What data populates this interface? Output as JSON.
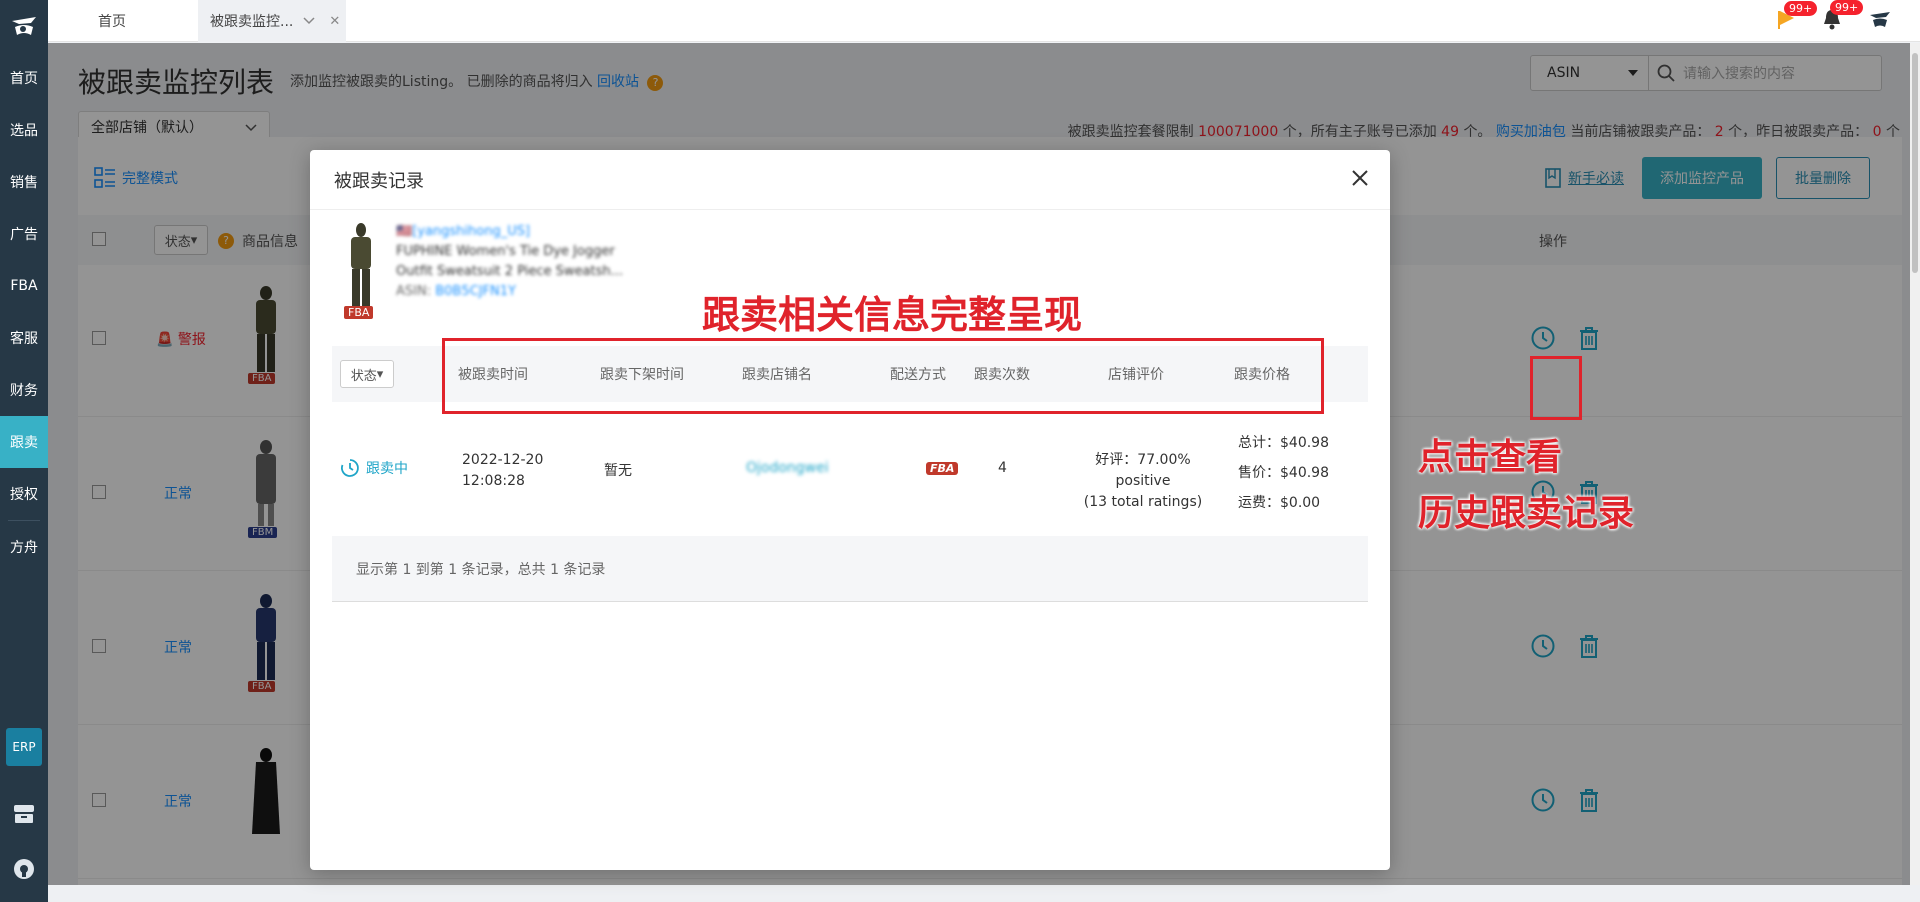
{
  "sidebar": {
    "items": [
      {
        "label": "首页"
      },
      {
        "label": "选品"
      },
      {
        "label": "销售"
      },
      {
        "label": "广告"
      },
      {
        "label": "FBA"
      },
      {
        "label": "客服"
      },
      {
        "label": "财务"
      },
      {
        "label": "跟卖"
      },
      {
        "label": "授权"
      },
      {
        "label": "方舟"
      }
    ],
    "active": "跟卖",
    "erp_label": "ERP"
  },
  "tabs": {
    "home": "首页",
    "current": "被跟卖监控..."
  },
  "notifications": {
    "flag_badge": "99+",
    "bell_badge": "99+"
  },
  "page": {
    "title": "被跟卖监控列表",
    "subtitle": "添加监控被跟卖的Listing。 已删除的商品将归入",
    "recycle_link": "回收站",
    "store_select": "全部店铺（默认）",
    "search_type": "ASIN",
    "search_placeholder": "请输入搜索的内容",
    "quota": {
      "prefix": "被跟卖监控套餐限制",
      "limit": "100071000",
      "mid1": "个，所有主子账号已添加",
      "added": "49",
      "mid2": "个。",
      "buy_link": "购买加油包",
      "mid3": "当前店铺被跟卖产品：",
      "current": "2",
      "mid4": "个，昨日被跟卖产品：",
      "yesterday": "0",
      "suffix": "个"
    },
    "mode_btn": "完整模式",
    "guide_link": "新手必读",
    "add_btn": "添加监控产品",
    "batch_delete_btn": "批量删除",
    "table": {
      "status_filter": "状态",
      "col_product": "商品信息",
      "col_ops": "操作",
      "rows": [
        {
          "status": "警报",
          "tag": "FBA"
        },
        {
          "status": "正常",
          "tag": "FBM"
        },
        {
          "status": "正常",
          "tag": "FBA"
        },
        {
          "status": "正常",
          "tag": ""
        }
      ]
    }
  },
  "modal": {
    "title": "被跟卖记录",
    "product": {
      "store": "[yangshihong_US]",
      "name_line1": "FUPHINE Women's Tie Dye Jogger",
      "name_line2": "Outfit Sweatsuit 2 Piece Sweatsh...",
      "asin_label": "ASIN:",
      "asin": "B0B5CJFN1Y",
      "tag": "FBA"
    },
    "table": {
      "status_filter": "状态",
      "headers": [
        "被跟卖时间",
        "跟卖下架时间",
        "跟卖店铺名",
        "配送方式",
        "跟卖次数",
        "店铺评价",
        "跟卖价格"
      ],
      "row": {
        "status": "跟卖中",
        "time_line1": "2022-12-20",
        "time_line2": "12:08:28",
        "offline": "暂无",
        "seller": "Ojodongwei",
        "delivery": "FBA",
        "count": "4",
        "rating_line1": "好评：77.00% positive",
        "rating_line2": "(13 total ratings)",
        "price_total": "总计：$40.98",
        "price_sale": "售价：$40.98",
        "price_ship": "运费：$0.00"
      },
      "footer": "显示第 1 到第 1 条记录，总共 1 条记录"
    }
  },
  "annotations": {
    "headline": "跟卖相关信息完整呈现",
    "side_line1": "点击查看",
    "side_line2": "历史跟卖记录"
  },
  "colors": {
    "sidebar": "#263846",
    "accent": "#38b1c6",
    "annotation_red": "#e0232b"
  }
}
